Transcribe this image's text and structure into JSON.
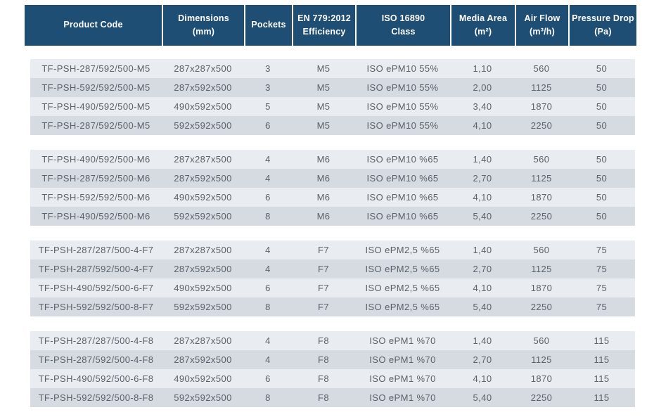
{
  "colors": {
    "header-bg": "#1f4e74",
    "header-text": "#ffffff",
    "row-light": "#e9ecf1",
    "row-dark": "#d6dbe2",
    "body-text": "#5b6168",
    "page-bg": "#ffffff"
  },
  "table": {
    "headers": [
      "Product Code",
      "Dimensions\n(mm)",
      "Pockets",
      "EN 779:2012\nEfficiency",
      "ISO 16890\nClass",
      "Media Area\n(m²)",
      "Air Flow\n(m³/h)",
      "Pressure Drop\n(Pa)"
    ],
    "column_keys": [
      "product-code",
      "dimensions",
      "pockets",
      "en779-efficiency",
      "iso16890-class",
      "media-area",
      "air-flow",
      "pressure-drop"
    ],
    "groups": [
      {
        "id": "M5",
        "rows": [
          [
            "TF-PSH-287/592/500-M5",
            "287x287x500",
            "3",
            "M5",
            "ISO ePM10 55%",
            "1,10",
            "560",
            "50"
          ],
          [
            "TF-PSH-592/592/500-M5",
            "287x592x500",
            "3",
            "M5",
            "ISO ePM10 55%",
            "2,00",
            "1125",
            "50"
          ],
          [
            "TF-PSH-490/592/500-M5",
            "490x592x500",
            "5",
            "M5",
            "ISO ePM10 55%",
            "3,40",
            "1870",
            "50"
          ],
          [
            "TF-PSH-287/592/500-M5",
            "592x592x500",
            "6",
            "M5",
            "ISO ePM10 55%",
            "4,10",
            "2250",
            "50"
          ]
        ]
      },
      {
        "id": "M6",
        "rows": [
          [
            "TF-PSH-490/592/500-M6",
            "287x287x500",
            "4",
            "M6",
            "ISO ePM10 %65",
            "1,40",
            "560",
            "50"
          ],
          [
            "TF-PSH-287/592/500-M6",
            "287x592x500",
            "4",
            "M6",
            "ISO ePM10 %65",
            "2,70",
            "1125",
            "50"
          ],
          [
            "TF-PSH-592/592/500-M6",
            "490x592x500",
            "6",
            "M6",
            "ISO ePM10 %65",
            "4,10",
            "1870",
            "50"
          ],
          [
            "TF-PSH-490/592/500-M6",
            "592x592x500",
            "8",
            "M6",
            "ISO ePM10 %65",
            "5,40",
            "2250",
            "50"
          ]
        ]
      },
      {
        "id": "F7",
        "rows": [
          [
            "TF-PSH-287/287/500-4-F7",
            "287x287x500",
            "4",
            "F7",
            "ISO ePM2,5 %65",
            "1,40",
            "560",
            "75"
          ],
          [
            "TF-PSH-287/592/500-4-F7",
            "287x592x500",
            "4",
            "F7",
            "ISO ePM2,5 %65",
            "2,70",
            "1125",
            "75"
          ],
          [
            "TF-PSH-490/592/500-6-F7",
            "490x592x500",
            "6",
            "F7",
            "ISO ePM2,5 %65",
            "4,10",
            "1870",
            "75"
          ],
          [
            "TF-PSH-592/592/500-8-F7",
            "592x592x500",
            "8",
            "F7",
            "ISO ePM2,5 %65",
            "5,40",
            "2250",
            "75"
          ]
        ]
      },
      {
        "id": "F8",
        "rows": [
          [
            "TF-PSH-287/287/500-4-F8",
            "287x287x500",
            "4",
            "F8",
            "ISO ePM1 %70",
            "1,40",
            "560",
            "115"
          ],
          [
            "TF-PSH-287/592/500-4-F8",
            "287x592x500",
            "4",
            "F8",
            "ISO ePM1 %70",
            "2,70",
            "1125",
            "115"
          ],
          [
            "TF-PSH-490/592/500-6-F8",
            "490x592x500",
            "6",
            "F8",
            "ISO ePM1 %70",
            "4,10",
            "1870",
            "115"
          ],
          [
            "TF-PSH-592/592/500-8-F8",
            "592x592x500",
            "8",
            "F8",
            "ISO ePM1 %70",
            "5,40",
            "2250",
            "115"
          ]
        ]
      }
    ]
  }
}
